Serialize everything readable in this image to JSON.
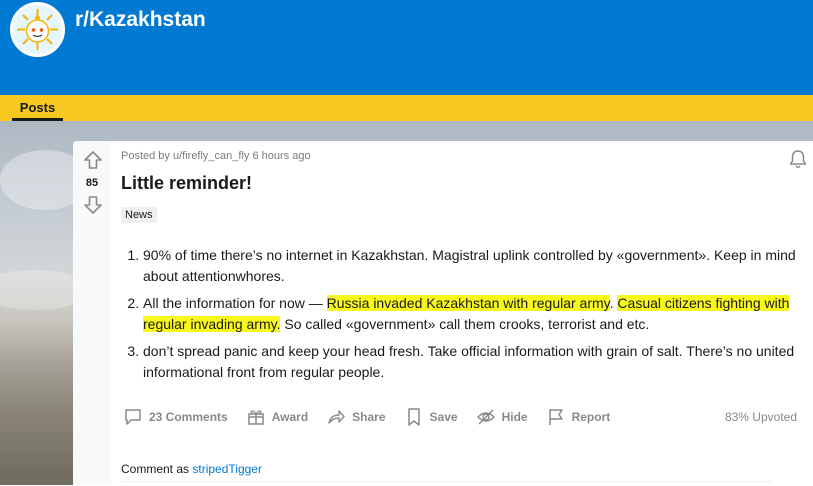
{
  "subreddit": {
    "name": "r/Kazakhstan"
  },
  "nav": {
    "tabs": [
      {
        "label": "Posts"
      }
    ]
  },
  "post": {
    "votes": "85",
    "meta": "Posted by u/firefly_can_fly 6 hours ago",
    "title": "Little reminder!",
    "flair": "News",
    "items": [
      {
        "text": "90% of time there’s no internet in Kazakhstan. Magistral uplink controlled by «government». Keep in mind about attentionwhores."
      },
      {
        "pre": "All the information for now — ",
        "hl1": "Russia invaded Kazakhstan with regular army",
        "mid": ". ",
        "hl2": "Casual citizens fighting with regular invading army.",
        "post": " So called «government» call them crooks, terrorist and etc."
      },
      {
        "text": "don’t spread panic and keep your head fresh. Take official information with grain of salt. There’s no united informational front from regular people."
      }
    ],
    "actions": {
      "comments": "23 Comments",
      "award": "Award",
      "share": "Share",
      "save": "Save",
      "hide": "Hide",
      "report": "Report"
    },
    "upvoted": "83% Upvoted"
  },
  "comment_as": {
    "label": "Comment as",
    "user": "stripedTigger"
  },
  "colors": {
    "header": "#0079d3",
    "nav": "#f6c820",
    "highlight": "#f8f81c",
    "link": "#0079d3"
  },
  "icons": [
    "upvote-icon",
    "downvote-icon",
    "bell-icon",
    "comment-icon",
    "gift-icon",
    "share-icon",
    "bookmark-icon",
    "hide-icon",
    "flag-icon"
  ]
}
